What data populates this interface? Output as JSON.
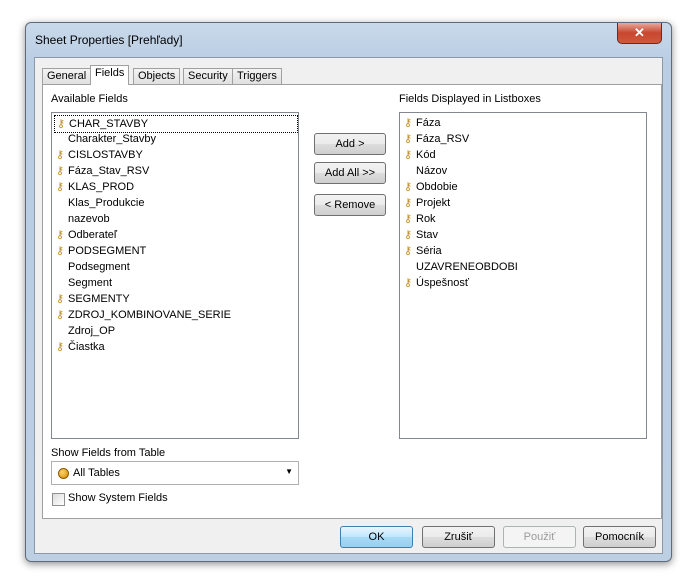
{
  "window": {
    "title": "Sheet Properties [Prehľady]",
    "close": "✕"
  },
  "tabs": [
    "General",
    "Fields",
    "Objects",
    "Security",
    "Triggers"
  ],
  "available": {
    "label": "Available Fields",
    "items": [
      {
        "t": "CHAR_STAVBY",
        "key": true
      },
      {
        "t": "Charakter_Stavby",
        "key": false
      },
      {
        "t": "CISLOSTAVBY",
        "key": true
      },
      {
        "t": "Fáza_Stav_RSV",
        "key": true
      },
      {
        "t": "KLAS_PROD",
        "key": true
      },
      {
        "t": "Klas_Produkcie",
        "key": false
      },
      {
        "t": "nazevob",
        "key": false
      },
      {
        "t": "Odberateľ",
        "key": true
      },
      {
        "t": "PODSEGMENT",
        "key": true
      },
      {
        "t": "Podsegment",
        "key": false
      },
      {
        "t": "Segment",
        "key": false
      },
      {
        "t": "SEGMENTY",
        "key": true
      },
      {
        "t": "ZDROJ_KOMBINOVANE_SERIE",
        "key": true
      },
      {
        "t": "Zdroj_OP",
        "key": false
      },
      {
        "t": "Čiastka",
        "key": true
      }
    ]
  },
  "displayed": {
    "label": "Fields Displayed in Listboxes",
    "items": [
      {
        "t": "Fáza",
        "key": true
      },
      {
        "t": "Fáza_RSV",
        "key": true
      },
      {
        "t": "Kód",
        "key": true
      },
      {
        "t": "Názov",
        "key": false
      },
      {
        "t": "Obdobie",
        "key": true
      },
      {
        "t": "Projekt",
        "key": true
      },
      {
        "t": "Rok",
        "key": true
      },
      {
        "t": "Stav",
        "key": true
      },
      {
        "t": "Séria",
        "key": true
      },
      {
        "t": "UZAVRENEOBDOBI",
        "key": false
      },
      {
        "t": "Úspešnosť",
        "key": true
      }
    ]
  },
  "buttons": {
    "add": "Add >",
    "add_all": "Add All >>",
    "remove": "< Remove",
    "ok": "OK",
    "cancel": "Zrušiť",
    "apply": "Použiť",
    "help": "Pomocník"
  },
  "table": {
    "label": "Show Fields from Table",
    "value": "All Tables"
  },
  "system": {
    "label": "Show System Fields",
    "checked": false
  }
}
